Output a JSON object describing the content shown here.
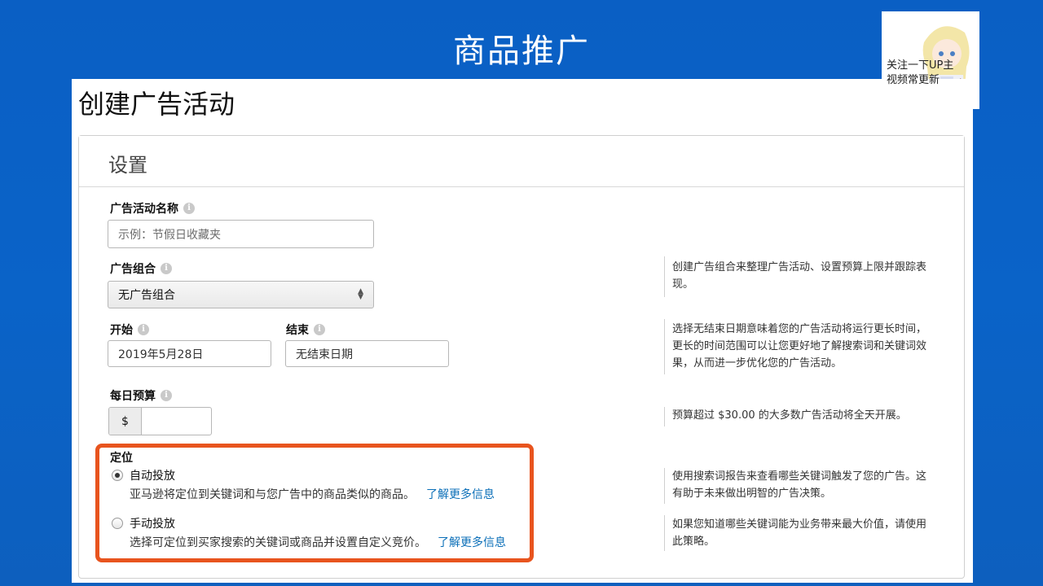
{
  "slide": {
    "title": "商品推广"
  },
  "badge": {
    "line1": "关注一下UP主",
    "line2": "视频常更新"
  },
  "page": {
    "title": "创建广告活动"
  },
  "settings": {
    "title": "设置",
    "campaign_name": {
      "label": "广告活动名称",
      "placeholder": "示例：节假日收藏夹"
    },
    "portfolio": {
      "label": "广告组合",
      "selected": "无广告组合",
      "help": "创建广告组合来整理广告活动、设置预算上限并跟踪表现。"
    },
    "start": {
      "label": "开始",
      "value": "2019年5月28日"
    },
    "end": {
      "label": "结束",
      "value": "无结束日期"
    },
    "dates_help": "选择无结束日期意味着您的广告活动将运行更长时间，更长的时间范围可以让您更好地了解搜索词和关键词效果，从而进一步优化您的广告活动。",
    "budget": {
      "label": "每日预算",
      "currency": "$",
      "value": "",
      "help": "预算超过 $30.00 的大多数广告活动将全天开展。"
    },
    "targeting": {
      "label": "定位",
      "auto": {
        "label": "自动投放",
        "description": "亚马逊将定位到关键词和与您广告中的商品类似的商品。",
        "link": "了解更多信息",
        "selected": true,
        "help": "使用搜索词报告来查看哪些关键词触发了您的广告。这有助于未来做出明智的广告决策。"
      },
      "manual": {
        "label": "手动投放",
        "description": "选择可定位到买家搜索的关键词或商品并设置自定义竞价。",
        "link": "了解更多信息",
        "selected": false,
        "help": "如果您知道哪些关键词能为业务带来最大价值，请使用此策略。"
      }
    }
  },
  "colors": {
    "background": "#0a5fc4",
    "highlight": "#e8541e",
    "link": "#0b6fb8"
  },
  "icons": {
    "info": "info-icon",
    "select_arrow": "sort-arrows-icon"
  }
}
